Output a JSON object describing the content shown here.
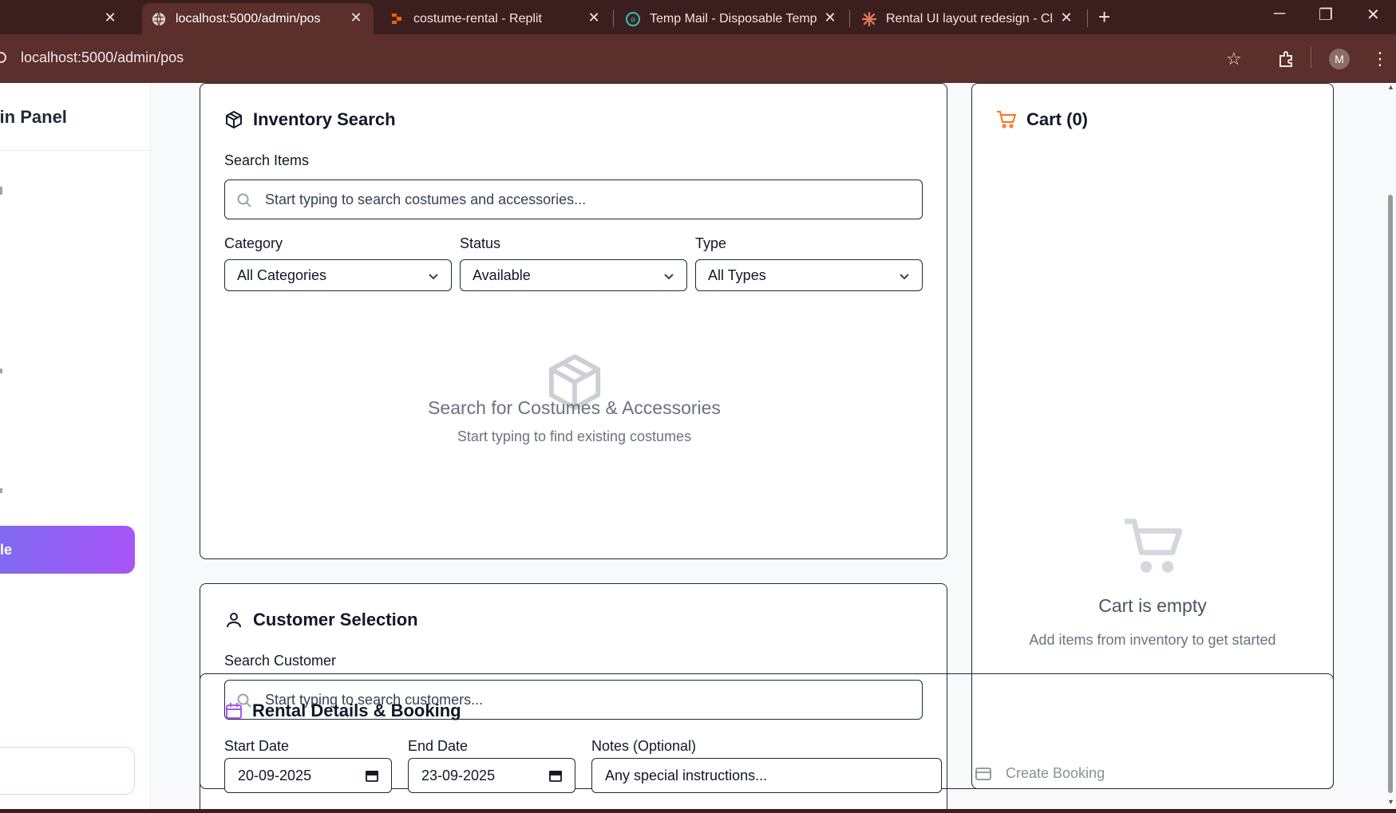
{
  "browser": {
    "tabs": [
      {
        "title": "",
        "active": false
      },
      {
        "title": "localhost:5000/admin/pos",
        "active": true
      },
      {
        "title": "costume-rental - Replit",
        "active": false
      },
      {
        "title": "Temp Mail - Disposable Tempor",
        "active": false
      },
      {
        "title": "Rental UI layout redesign - Clau",
        "active": false
      }
    ],
    "new_tab": "+",
    "url": "localhost:5000/admin/pos",
    "profile_initial": "M",
    "window_controls": {
      "minimize": "─",
      "restore": "❐",
      "close": "✕"
    }
  },
  "sidebar": {
    "title": "min Panel",
    "cta_label": "le"
  },
  "inventory": {
    "title": "Inventory Search",
    "search_label": "Search Items",
    "search_placeholder": "Start typing to search costumes and accessories...",
    "category_label": "Category",
    "category_value": "All Categories",
    "status_label": "Status",
    "status_value": "Available",
    "type_label": "Type",
    "type_value": "All Types",
    "empty_title": "Search for Costumes & Accessories",
    "empty_subtitle": "Start typing to find existing costumes"
  },
  "customer": {
    "title": "Customer Selection",
    "search_label": "Search Customer",
    "search_placeholder": "Start typing to search customers..."
  },
  "rental": {
    "title": "Rental Details & Booking",
    "start_label": "Start Date",
    "start_value": "20-09-2025",
    "end_label": "End Date",
    "end_value": "23-09-2025",
    "notes_label": "Notes (Optional)",
    "notes_placeholder": "Any special instructions...",
    "create_label": "Create Booking"
  },
  "cart": {
    "title": "Cart (0)",
    "empty_title": "Cart is empty",
    "empty_subtitle": "Add items from inventory to get started"
  },
  "colors": {
    "chrome_bg": "#3b1f1e",
    "addr_bg": "#5a2f2c",
    "accent_cart": "#f97316",
    "accent_calendar": "#a855f7",
    "cta_gradient_start": "#7c6cf0",
    "cta_gradient_end": "#a855f7"
  }
}
